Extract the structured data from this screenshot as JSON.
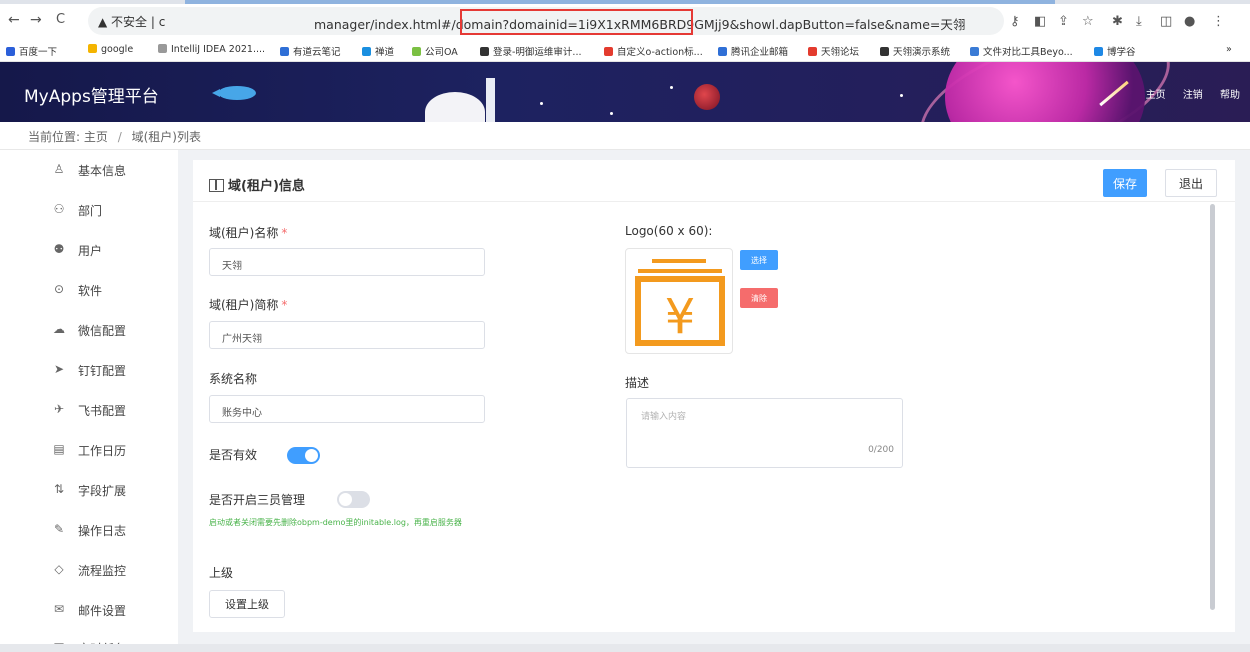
{
  "browser": {
    "security_label": "不安全",
    "url_prefix": "c",
    "url_text": "manager/index.html#/domain?domainid=1i9X1xRMM6BRD9GMjj9&showl.dapButton=false&name=天翎",
    "bookmarks": [
      {
        "label": "百度一下",
        "color": "#2b5fd9"
      },
      {
        "label": "google",
        "color": "#f4b400"
      },
      {
        "label": "IntelliJ IDEA 2021....",
        "color": "#999999"
      },
      {
        "label": "有道云笔记",
        "color": "#2f6fd6"
      },
      {
        "label": "禅道",
        "color": "#1a8fe0"
      },
      {
        "label": "公司OA",
        "color": "#7bc043"
      },
      {
        "label": "登录-明御运维审计...",
        "color": "#333333"
      },
      {
        "label": "自定义o-action标...",
        "color": "#e33b2e"
      },
      {
        "label": "腾讯企业邮箱",
        "color": "#2f6fd6"
      },
      {
        "label": "天翎论坛",
        "color": "#e33b2e"
      },
      {
        "label": "天翎演示系统",
        "color": "#333333"
      },
      {
        "label": "文件对比工具Beyo...",
        "color": "#3a7bd5"
      },
      {
        "label": "博学谷",
        "color": "#1e88e5"
      }
    ]
  },
  "header": {
    "brand": "MyApps管理平台",
    "links": [
      "主页",
      "注销",
      "帮助"
    ]
  },
  "breadcrumb": {
    "prefix": "当前位置:",
    "items": [
      "主页",
      "域(租户)列表"
    ]
  },
  "sidebar": {
    "items": [
      {
        "icon": "user-icon",
        "glyph": "♙",
        "label": "基本信息"
      },
      {
        "icon": "department-icon",
        "glyph": "⚇",
        "label": "部门"
      },
      {
        "icon": "users-icon",
        "glyph": "⚉",
        "label": "用户"
      },
      {
        "icon": "software-icon",
        "glyph": "⊙",
        "label": "软件"
      },
      {
        "icon": "wechat-icon",
        "glyph": "☁",
        "label": "微信配置"
      },
      {
        "icon": "dingtalk-icon",
        "glyph": "➤",
        "label": "钉钉配置"
      },
      {
        "icon": "feishu-icon",
        "glyph": "✈",
        "label": "飞书配置"
      },
      {
        "icon": "calendar-icon",
        "glyph": "▤",
        "label": "工作日历"
      },
      {
        "icon": "field-extend-icon",
        "glyph": "⇅",
        "label": "字段扩展"
      },
      {
        "icon": "log-icon",
        "glyph": "✎",
        "label": "操作日志"
      },
      {
        "icon": "flow-monitor-icon",
        "glyph": "◇",
        "label": "流程监控"
      },
      {
        "icon": "mail-icon",
        "glyph": "✉",
        "label": "邮件设置"
      },
      {
        "icon": "timer-icon",
        "glyph": "▤",
        "label": "定时任务"
      }
    ]
  },
  "card": {
    "title": "域(租户)信息",
    "save_label": "保存",
    "exit_label": "退出"
  },
  "form": {
    "name_label": "域(租户)名称",
    "name_value": "天翎",
    "short_label": "域(租户)简称",
    "short_value": "广州天翎",
    "system_label": "系统名称",
    "system_value": "账务中心",
    "valid_label": "是否有效",
    "valid_on": true,
    "three_admin_label": "是否开启三员管理",
    "three_admin_on": false,
    "hint": "启动或者关闭需要先删除obpm-demo里的initable.log，再重启服务器",
    "parent_label": "上级",
    "parent_button": "设置上级",
    "logo_label": "Logo(60 x 60):",
    "choose_label": "选择",
    "clear_label": "清除",
    "desc_label": "描述",
    "desc_placeholder": "请输入内容",
    "desc_count": "0/200"
  },
  "colors": {
    "primary": "#409eff",
    "danger": "#f56c6c",
    "header_bg": "#1d2260",
    "logo_orange": "#f39a1e",
    "hint_green": "#49b34a"
  }
}
